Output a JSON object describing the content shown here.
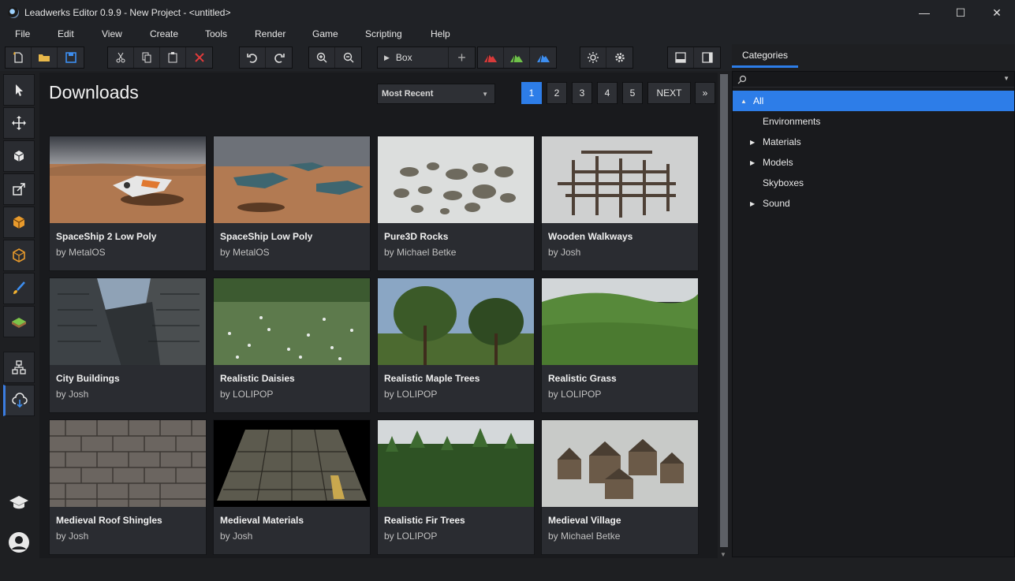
{
  "window": {
    "title": "Leadwerks Editor 0.9.9 - New Project - <untitled>",
    "minimize_glyph": "—",
    "maximize_glyph": "☐",
    "close_glyph": "✕"
  },
  "menu": [
    "File",
    "Edit",
    "View",
    "Create",
    "Tools",
    "Render",
    "Game",
    "Scripting",
    "Help"
  ],
  "toolbar": {
    "brush_shape": "Box",
    "add_glyph": "+"
  },
  "main": {
    "title": "Downloads",
    "sort": "Most Recent",
    "pages": [
      "1",
      "2",
      "3",
      "4",
      "5"
    ],
    "next_label": "NEXT",
    "last_label": "»",
    "active_page": "1"
  },
  "items": [
    {
      "title": "SpaceShip 2 Low Poly",
      "author": "by MetalOS"
    },
    {
      "title": "SpaceShip Low Poly",
      "author": "by MetalOS"
    },
    {
      "title": "Pure3D Rocks",
      "author": "by Michael Betke"
    },
    {
      "title": "Wooden Walkways",
      "author": "by Josh"
    },
    {
      "title": "City Buildings",
      "author": "by Josh"
    },
    {
      "title": "Realistic Daisies",
      "author": "by LOLIPOP"
    },
    {
      "title": "Realistic Maple Trees",
      "author": "by LOLIPOP"
    },
    {
      "title": "Realistic Grass",
      "author": "by LOLIPOP"
    },
    {
      "title": "Medieval Roof Shingles",
      "author": "by Josh"
    },
    {
      "title": "Medieval Materials",
      "author": "by Josh"
    },
    {
      "title": "Realistic Fir Trees",
      "author": "by LOLIPOP"
    },
    {
      "title": "Medieval Village",
      "author": "by Michael Betke"
    }
  ],
  "categories": {
    "tab": "Categories",
    "tree": [
      {
        "label": "All",
        "expanded": true,
        "selected": true
      },
      {
        "label": "Environments"
      },
      {
        "label": "Materials",
        "has_children": true
      },
      {
        "label": "Models",
        "has_children": true
      },
      {
        "label": "Skyboxes"
      },
      {
        "label": "Sound",
        "has_children": true
      }
    ]
  },
  "colors": {
    "accent": "#2d7de8",
    "background": "#1e1f22"
  }
}
